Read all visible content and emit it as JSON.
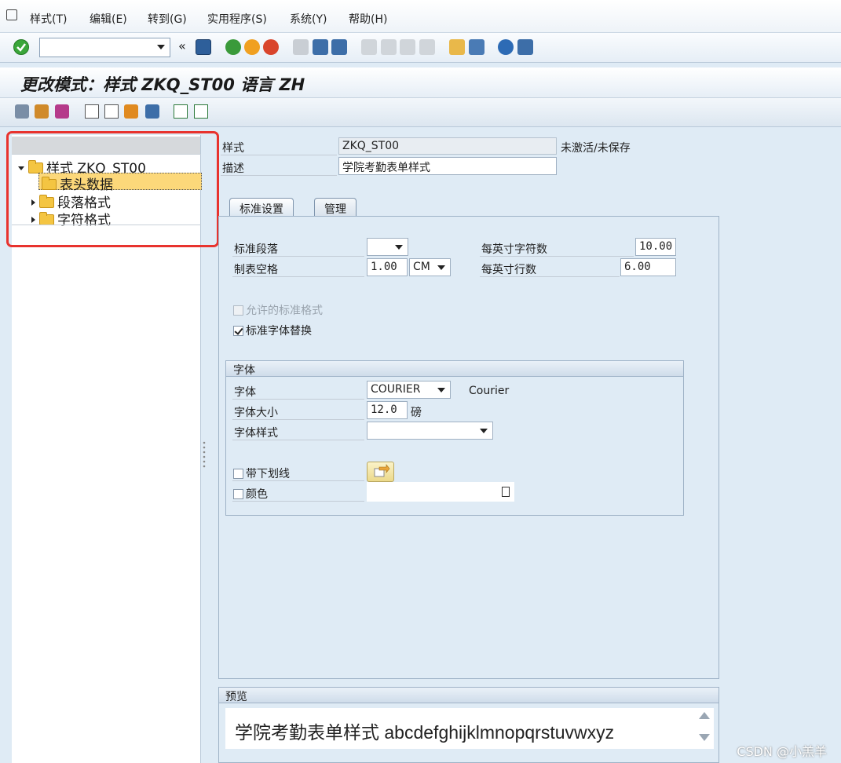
{
  "menu": {
    "items": [
      "样式(T)",
      "编辑(E)",
      "转到(G)",
      "实用程序(S)",
      "系统(Y)",
      "帮助(H)"
    ]
  },
  "toolbar": {
    "command_field_value": "",
    "history_glyph": "«"
  },
  "window": {
    "title": "更改模式：样式 ZKQ_ST00 语言 ZH"
  },
  "tree": {
    "root_label": "样式 ZKQ_ST00",
    "children": [
      {
        "label": "表头数据",
        "selected": true
      },
      {
        "label": "段落格式",
        "selected": false
      },
      {
        "label": "字符格式",
        "selected": false
      }
    ]
  },
  "header_fields": {
    "style_label": "样式",
    "style_value": "ZKQ_ST00",
    "status_text": "未激活/未保存",
    "desc_label": "描述",
    "desc_value": "学院考勤表单样式"
  },
  "tabs": [
    {
      "label": "标准设置",
      "active": true
    },
    {
      "label": "管理",
      "active": false
    }
  ],
  "standard": {
    "std_para_label": "标准段落",
    "std_para_value": "",
    "tab_space_label": "制表空格",
    "tab_space_value": "1.00",
    "tab_space_unit": "CM",
    "chars_per_inch_label": "每英寸字符数",
    "chars_per_inch_value": "10.00",
    "lines_per_inch_label": "每英寸行数",
    "lines_per_inch_value": "6.00",
    "allowed_std_formats_label": "允许的标准格式",
    "allowed_std_formats_checked": false,
    "std_font_subst_label": "标准字体替换",
    "std_font_subst_checked": true
  },
  "font_group": {
    "title": "字体",
    "font_label": "字体",
    "font_value": "COURIER",
    "font_desc": "Courier",
    "size_label": "字体大小",
    "size_value": "12.0",
    "size_unit": "磅",
    "style_label": "字体样式",
    "style_value": "",
    "underline_label": "带下划线",
    "underline_checked": false,
    "color_label": "颜色",
    "color_checked": false,
    "color_value": ""
  },
  "preview": {
    "title": "预览",
    "text": "学院考勤表单样式 abcdefghijklmnopqrstuvwxyz"
  },
  "watermark": "CSDN @小羔羊",
  "colors": {
    "highlight": "#e8332e",
    "selected_node": "#fcd87a",
    "background": "#dfebf5"
  }
}
